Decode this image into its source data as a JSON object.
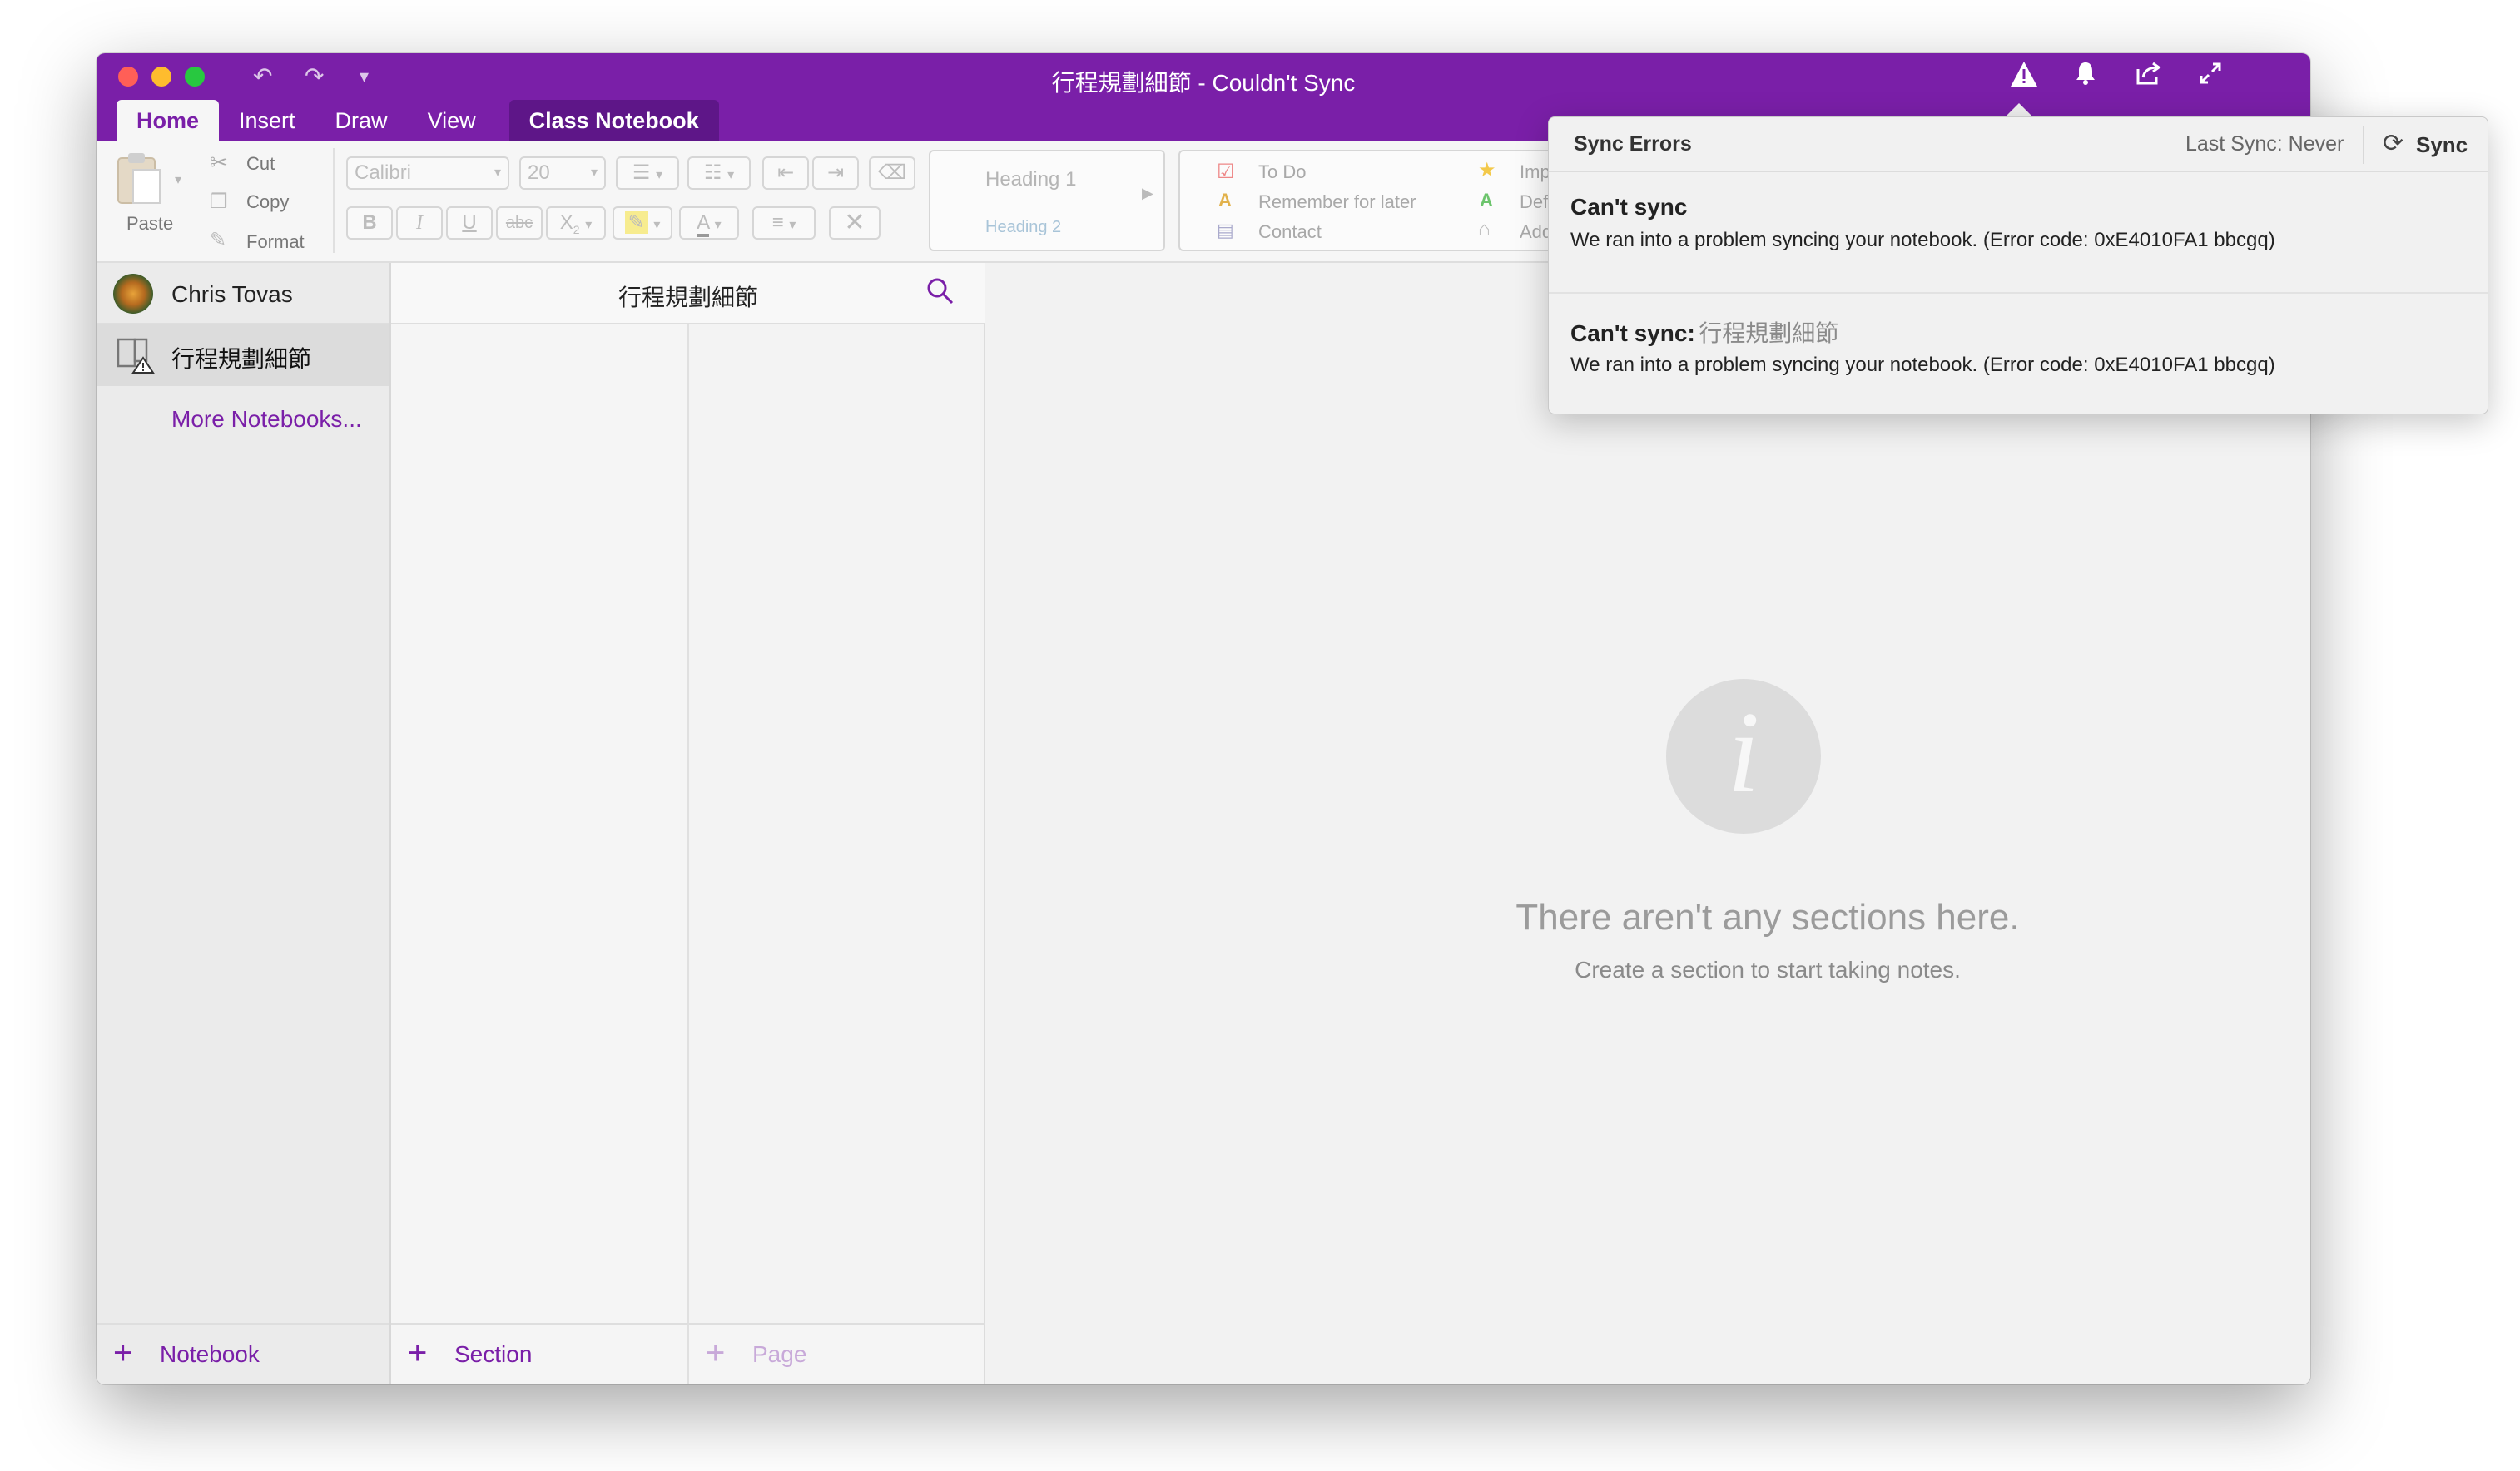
{
  "window": {
    "title": "行程規劃細節 - Couldn't Sync",
    "tabs": [
      "Home",
      "Insert",
      "Draw",
      "View",
      "Class Notebook"
    ]
  },
  "ribbon": {
    "paste": "Paste",
    "cut": "Cut",
    "copy": "Copy",
    "format": "Format",
    "font_name": "Calibri",
    "font_size": "20",
    "bold": "B",
    "italic": "I",
    "underline": "U",
    "strikethrough": "abc",
    "subscript": "X",
    "font_color": "A",
    "styles": [
      "Heading 1",
      "Heading 2"
    ],
    "tags": [
      "To Do",
      "Remember for later",
      "Contact",
      "Imp",
      "Defi",
      "Add"
    ]
  },
  "notebooks": {
    "user_name": "Chris Tovas",
    "current": "行程規劃細節",
    "more": "More Notebooks...",
    "add_label": "Notebook"
  },
  "sections": {
    "header_title": "行程規劃細節",
    "add_section_label": "Section",
    "add_page_label": "Page"
  },
  "empty_state": {
    "heading": "There aren't any sections here.",
    "subtext": "Create a section to start taking notes."
  },
  "sync_popover": {
    "title": "Sync Errors",
    "last_sync": "Last Sync: Never",
    "sync_button": "Sync",
    "errors": [
      {
        "title": "Can't sync",
        "notebook": "",
        "message": "We ran into a problem syncing your notebook. (Error code: 0xE4010FA1 bbcgq)"
      },
      {
        "title": "Can't sync:",
        "notebook": "行程規劃細節",
        "message": "We ran into a problem syncing your notebook. (Error code: 0xE4010FA1 bbcgq)"
      }
    ]
  },
  "colors": {
    "accent": "#7a1fa8",
    "titlebar": "#7a1fa8",
    "close": "#ff5f57",
    "minimize": "#febc2e",
    "zoom": "#28c840"
  }
}
